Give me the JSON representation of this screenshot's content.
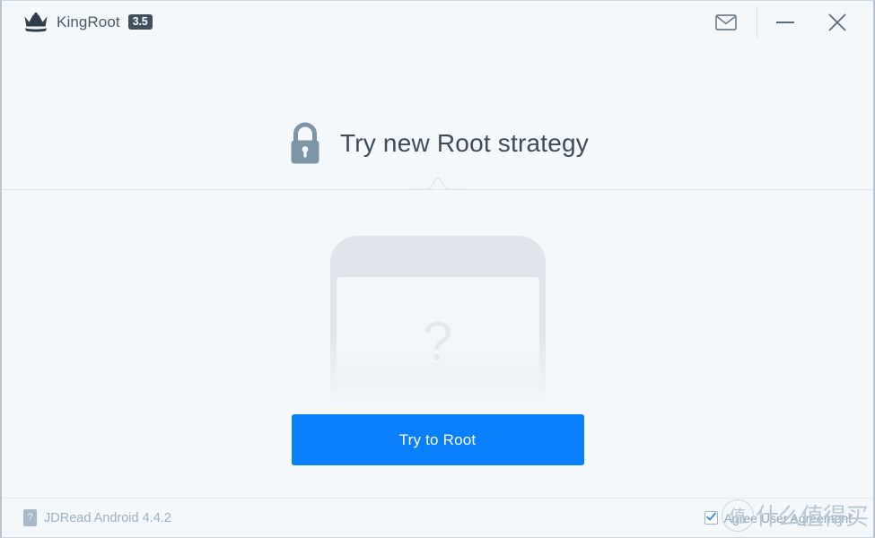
{
  "window": {
    "background_color": "#f4f8fb",
    "border_color": "#b9c6d1"
  },
  "titlebar": {
    "brand_name": "KingRoot",
    "version_badge": "3.5",
    "badge_bg_color": "#414f5c",
    "crown_icon": "crown-icon",
    "actions": [
      {
        "name": "mail-icon",
        "label": "Mail"
      },
      {
        "name": "minimize-icon",
        "label": "Minimize"
      },
      {
        "name": "close-icon",
        "label": "Close"
      }
    ]
  },
  "headline": {
    "icon": "lock-icon",
    "text": "Try new Root strategy",
    "text_color": "#3f4c58"
  },
  "illustration": {
    "name": "unknown-device-phone-illustration",
    "placeholder_glyph": "?",
    "phone_color": "#dfe5eb",
    "screen_color": "#f3f7fa"
  },
  "main": {
    "primary_button_label": "Try to Root",
    "primary_button_color": "#097ffb",
    "primary_button_text_color": "#ffffff"
  },
  "statusbar": {
    "help_badge": "?",
    "device_text": "JDRead Android 4.4.2",
    "device_text_color": "#9fb0bf",
    "agreement_label": "Agree User Agreement",
    "agreement_checked": true
  },
  "watermark": {
    "circle_glyph": "值",
    "text": "什么值得买"
  }
}
